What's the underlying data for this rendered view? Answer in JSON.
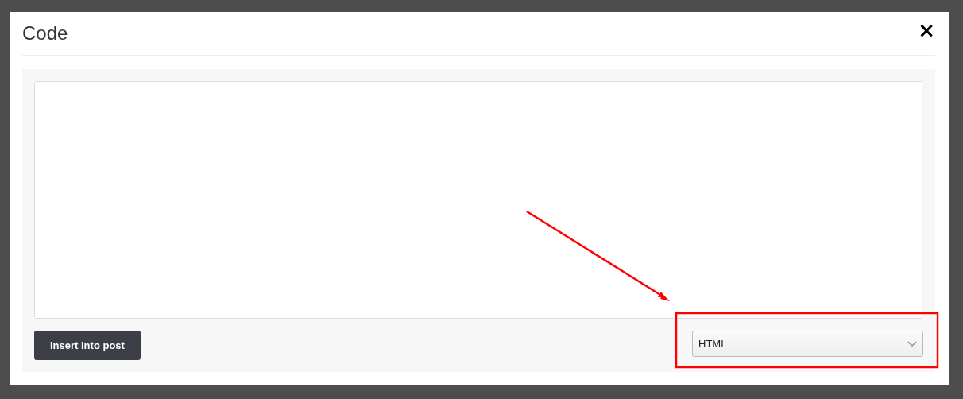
{
  "dialog": {
    "title": "Code",
    "close_label": "×"
  },
  "insert_button": {
    "label": "Insert into post"
  },
  "language_select": {
    "value": "HTML"
  }
}
